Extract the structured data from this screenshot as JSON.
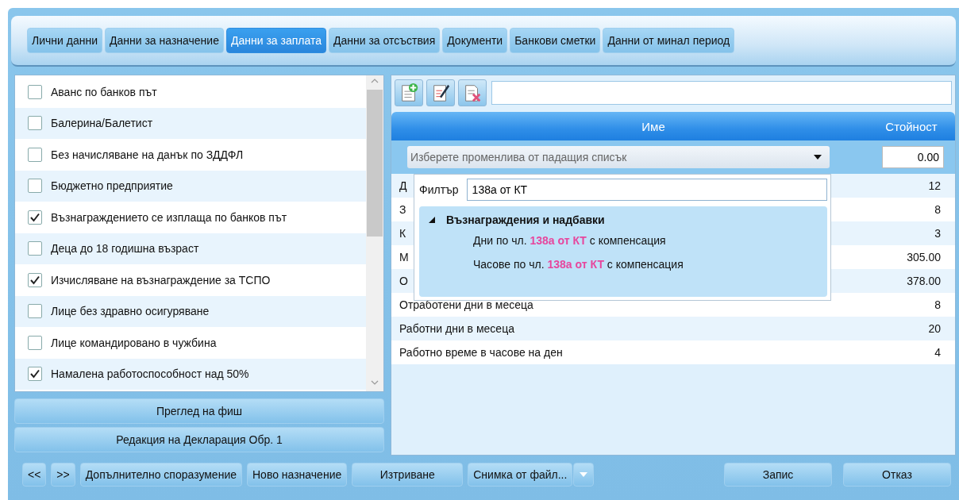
{
  "tabs": [
    {
      "label": "Лични данни",
      "selected": false
    },
    {
      "label": "Данни за назначение",
      "selected": false
    },
    {
      "label": "Данни за заплата",
      "selected": true
    },
    {
      "label": "Данни за отсъствия",
      "selected": false
    },
    {
      "label": "Документи",
      "selected": false
    },
    {
      "label": "Банкови сметки",
      "selected": false
    },
    {
      "label": "Данни от минал период",
      "selected": false
    }
  ],
  "checklist": [
    {
      "label": "Аванс по банков път",
      "checked": false
    },
    {
      "label": "Балерина/Балетист",
      "checked": false
    },
    {
      "label": "Без начисляване на данък по ЗДДФЛ",
      "checked": false
    },
    {
      "label": "Бюджетно предприятие",
      "checked": false
    },
    {
      "label": "Възнаграждението се изплаща по банков път",
      "checked": true
    },
    {
      "label": "Деца до 18 годишна възраст",
      "checked": false
    },
    {
      "label": "Изчисляване на възнаграждение за ТСПО",
      "checked": true
    },
    {
      "label": "Лице без здравно осигуряване",
      "checked": false
    },
    {
      "label": "Лице командировано в чужбина",
      "checked": false
    },
    {
      "label": "Намалена работоспособност над 50%",
      "checked": true
    }
  ],
  "side_buttons": [
    "Преглед на фиш",
    "Редакция на Декларация Обр. 1"
  ],
  "table": {
    "columns": [
      "Име",
      "Стойност"
    ],
    "editor": {
      "placeholder": "Изберете променлива от падащия списък",
      "value": "0.00"
    },
    "rows": [
      {
        "name": "Д",
        "value": "12"
      },
      {
        "name": "З",
        "value": "8"
      },
      {
        "name": "К",
        "value": "3"
      },
      {
        "name": "М",
        "value": "305.00"
      },
      {
        "name": "О",
        "value": "378.00"
      },
      {
        "name": "Отработени дни в месеца",
        "value": "8"
      },
      {
        "name": "Работни дни в месеца",
        "value": "20"
      },
      {
        "name": "Работно време в часове на ден",
        "value": "4"
      }
    ]
  },
  "dropdown": {
    "filter_label": "Филтър",
    "filter_value": "138а от КТ",
    "groups": [
      {
        "label": "Възнаграждения и надбавки",
        "expanded": true,
        "children": [
          {
            "text": "Дни по чл. **138а от КТ** с компенсация"
          },
          {
            "text": "Часове по чл. **138а от КТ** с компенсация"
          }
        ]
      }
    ]
  },
  "footer": {
    "left": [
      {
        "label": "<<",
        "kind": "plain"
      },
      {
        "label": ">>",
        "kind": "plain"
      },
      {
        "label": "Допълнително споразумение",
        "kind": "plain"
      },
      {
        "label": "Ново назначение",
        "kind": "plain"
      },
      {
        "label": "Изтриване",
        "kind": "plain"
      },
      {
        "label": "Снимка от файл...",
        "kind": "split"
      }
    ],
    "right": [
      {
        "label": "Запис",
        "kind": "plain"
      },
      {
        "label": "Отказ",
        "kind": "plain"
      }
    ]
  }
}
